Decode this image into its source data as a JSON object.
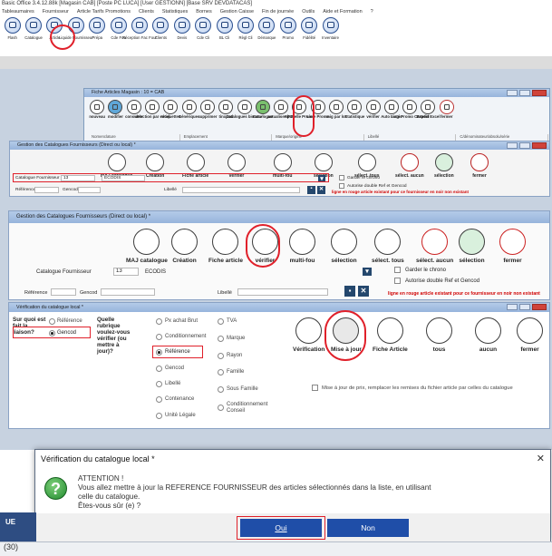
{
  "app": {
    "title": "Basic Office 3.4.12.88k  [Magasin CAB]  [Poste PC LUCA]  [User GESTIONN]  [Base SRV DEVDATACAS]",
    "menu": [
      "Tableaumaires",
      "Fournisseur",
      "Article Tarifs Promotions",
      "Clients",
      "Statistiques",
      "Bornes",
      "Gestion Caisse",
      "Fin de journée",
      "Outils",
      "Aide et Formation",
      "?"
    ],
    "toolbar": [
      "Flash",
      "Catalogue",
      "Article",
      "Liquide Fournisseur",
      "Prépa",
      "Cde Fou",
      "Réception Fac Four",
      "Clients",
      "Devis",
      "Cde Cli",
      "BL Cli",
      "Règl Cli",
      "Démarque",
      "Promo",
      "Fidélité",
      "Inventaire"
    ]
  },
  "w1": {
    "title": "Fiche Articles Magasin : 10 = CAB",
    "buttons": [
      "nouveau",
      "modifier",
      "consulter",
      "selection par excel",
      "rétiquettes",
      "Génériques",
      "supprimer",
      "tinxpod",
      "Catalogues biosour",
      "Cata-logue",
      "actualiser (FS)",
      "Nouvelle Promo",
      "Liste Promo",
      "mig par lot",
      "Statistique",
      "vérifier",
      "Auto magic",
      "Liste Promo Cartefid",
      "Export Excel",
      "fermer"
    ],
    "columns": [
      "Nomenclature",
      "Emplacement",
      "Marque/origine",
      "Libellé",
      "C/dénominateur/absolu/série"
    ]
  },
  "w2": {
    "title": "Gestion des Catalogues Fournisseurs (Direct ou local) *",
    "buttons": [
      "MAJ catalogue",
      "Création",
      "Fiche article",
      "vérifier",
      "multi-fou",
      "sélection",
      "sélect. tous",
      "sélect. aucun",
      "sélection",
      "fermer"
    ],
    "catalogue_label": "Catalogue Fournisseur",
    "catalogue_code": "13",
    "catalogue_name": "ECODIS",
    "reference_label": "Référence",
    "gencod_label": "Gencod",
    "libelle_label": "Libellé",
    "check_chrono": "Garder le chrono",
    "check_double": "Autorise double Ref et Gencod",
    "note": "ligne en rouge article existant pour ce fournisseur en noir non existant"
  },
  "w3": {
    "title": "Gestion des Catalogues Fournisseurs (Direct ou local) *",
    "buttons": [
      "MAJ catalogue",
      "Création",
      "Fiche article",
      "vérifier",
      "multi-fou",
      "sélection",
      "sélect. tous",
      "sélect. aucun",
      "sélection",
      "fermer"
    ],
    "catalogue_label": "Catalogue Fournisseur",
    "catalogue_code": "13",
    "catalogue_name": "ECODIS",
    "reference_label": "Référence",
    "gencod_label": "Gencod",
    "libelle_label": "Libellé",
    "check_chrono": "Garder le chrono",
    "check_double": "Autorise double Ref et Gencod",
    "note": "ligne en rouge article existant pour ce fournisseur en noir non existant"
  },
  "w4": {
    "title": "Vérification du catalogue local *",
    "question1": "Sur quoi est fait la liaison?",
    "opt_reference": "Référence",
    "opt_gencod": "Gencod",
    "question2": "Quelle rubrique voulez-vous vérifier (ou mettre à jour)?",
    "fields_col1": [
      "Px achat Brut",
      "Conditionnement",
      "Référence",
      "Gencod",
      "Libellé",
      "Contenance",
      "Unité Légale"
    ],
    "fields_col2": [
      "TVA",
      "Marque",
      "Rayon",
      "Famille",
      "Sous Famille",
      "Conditionnement Conseil"
    ],
    "buttons": [
      "Vérification",
      "Mise à jour",
      "Fiche Article",
      "tous",
      "aucun",
      "fermer"
    ],
    "maj_option": "Mise à jour de prix, remplacer les remises du fichier article par celles du catalogue"
  },
  "dialog": {
    "title": "Vérification du catalogue local *",
    "lines": [
      "ATTENTION !",
      "Vous allez mettre à jour la REFERENCE FOURNISSEUR des articles sélectionnés dans la liste, en utilisant",
      "celle du catalogue.",
      "Êtes-vous sûr (e) ?"
    ],
    "yes": "Oui",
    "no": "Non"
  },
  "strip": {
    "left_text": "UE",
    "bottom_text": "(30)"
  },
  "colors": {
    "highlight_red": "#e0202a",
    "dialog_button": "#1f4ea8",
    "title_gradient": "#97b4dc"
  }
}
